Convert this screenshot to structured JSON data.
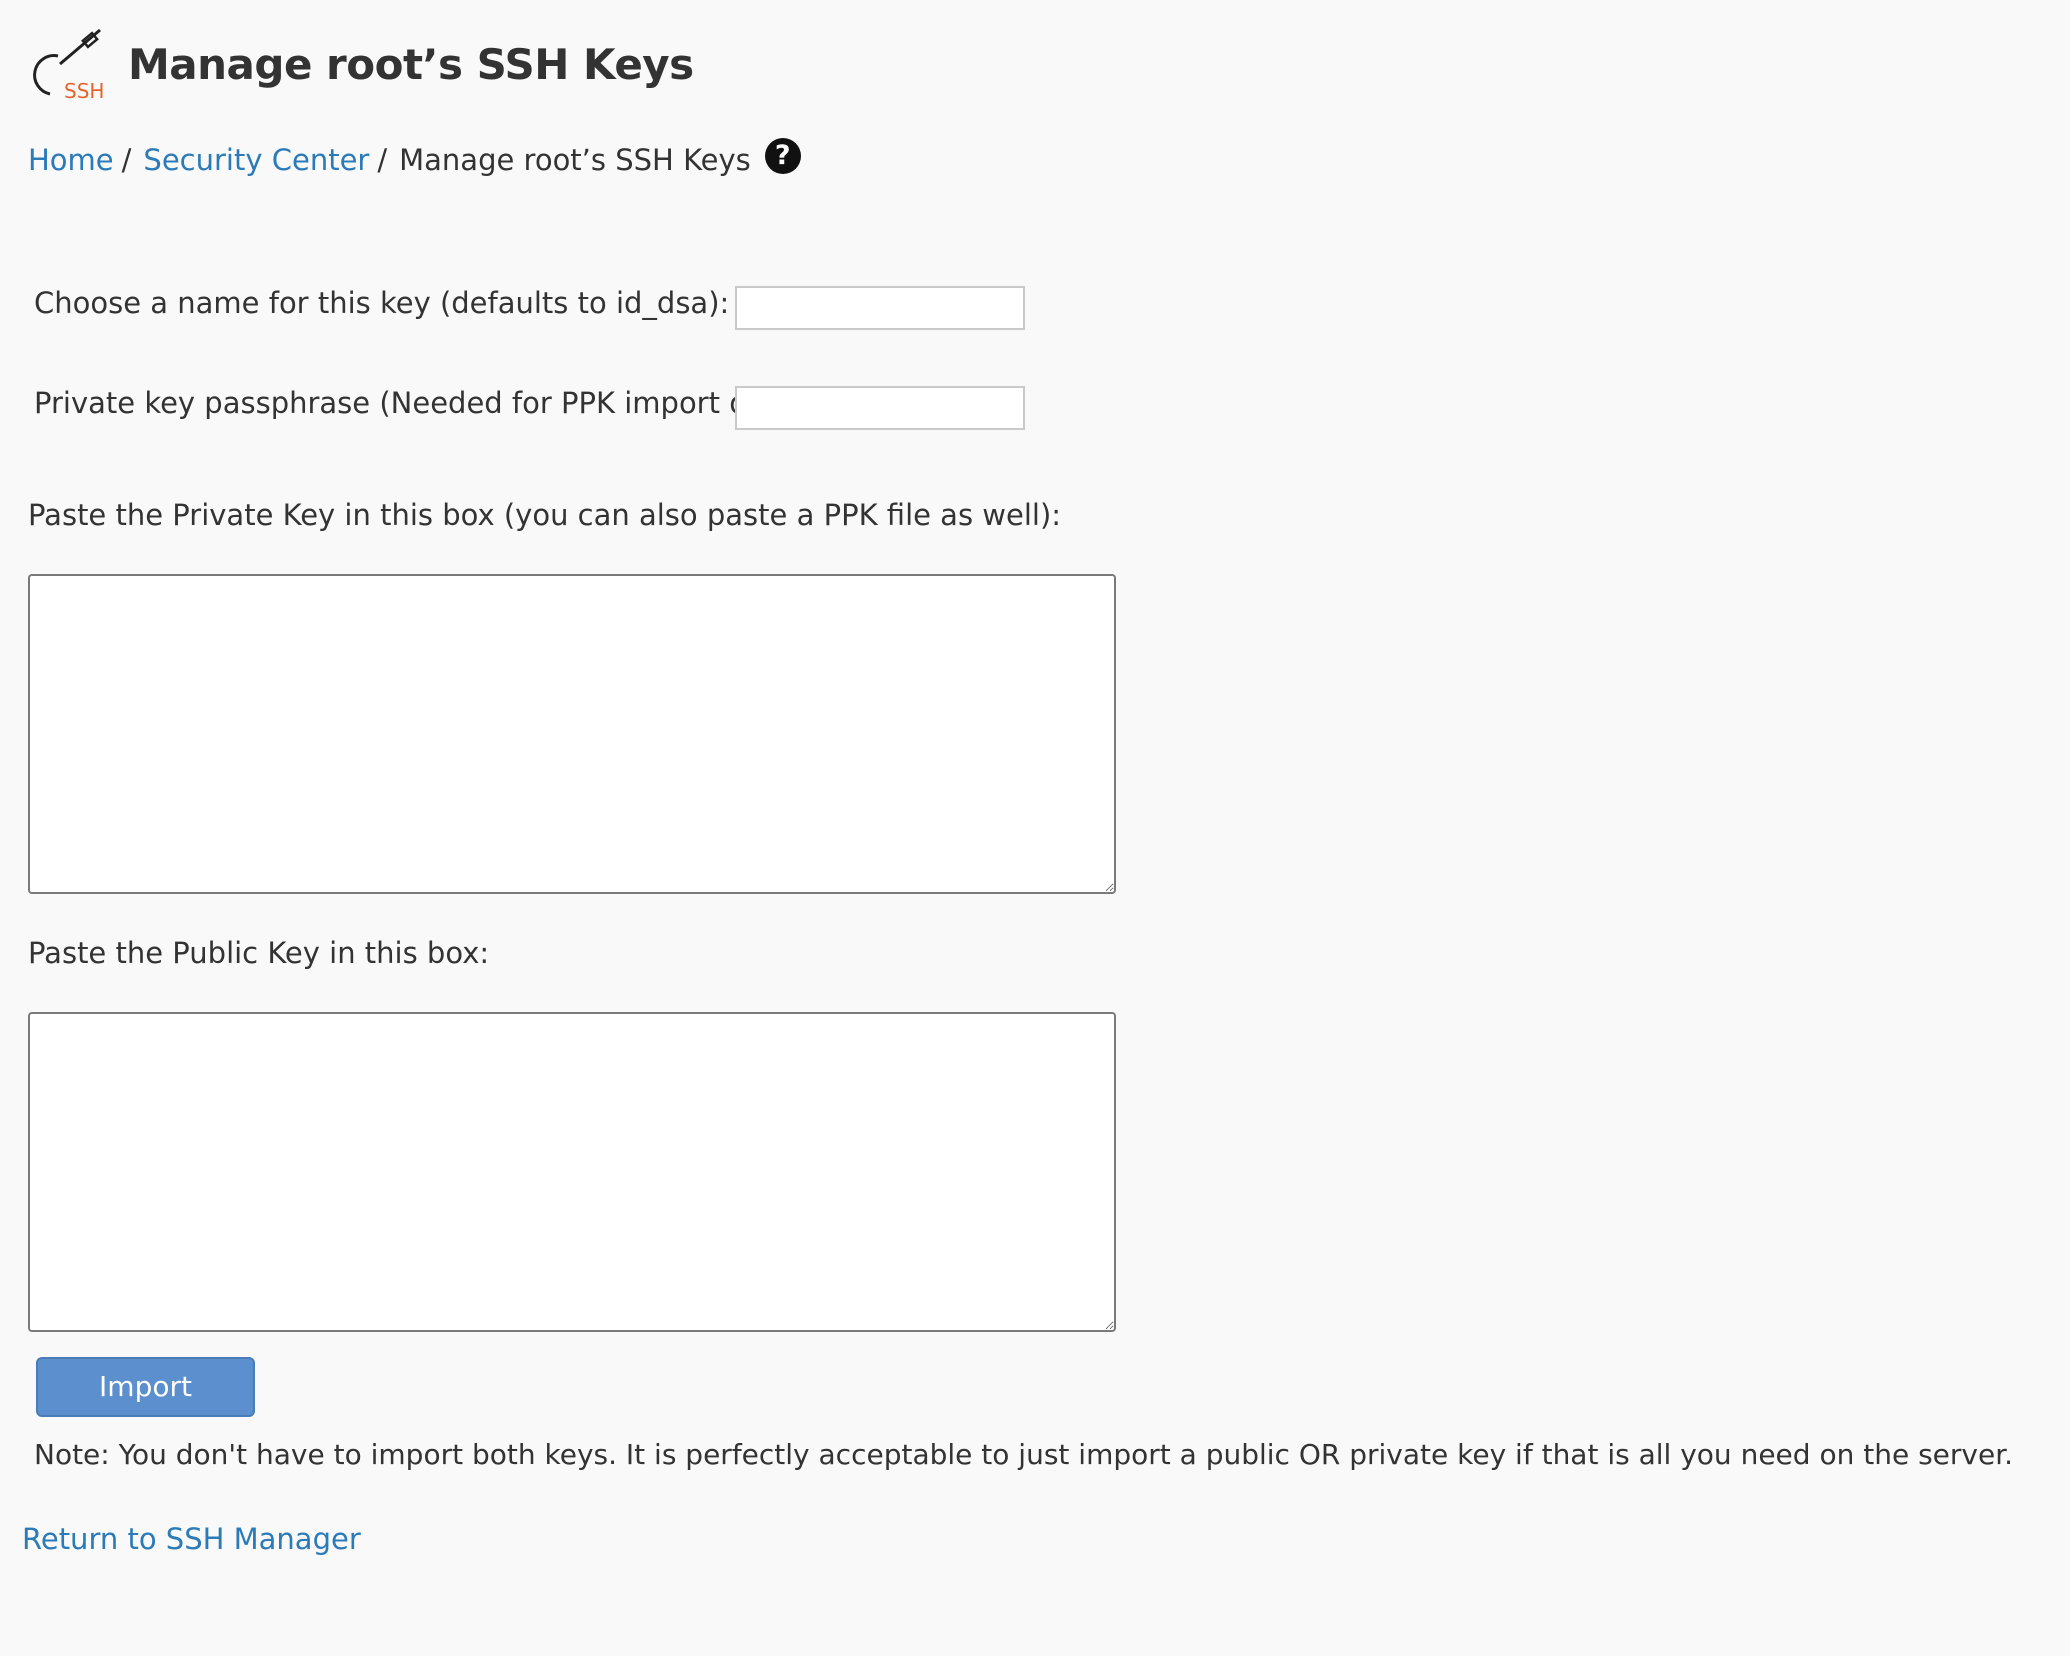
{
  "header": {
    "title": "Manage root’s SSH Keys",
    "logo_text": "SSH",
    "logo_icon": "ssh-key-icon"
  },
  "breadcrumb": {
    "items": [
      {
        "label": "Home"
      },
      {
        "label": "Security Center"
      },
      {
        "label": "Manage root’s SSH Keys"
      }
    ],
    "separator": "/",
    "help_icon": "question-circle-icon",
    "help_glyph": "?"
  },
  "form": {
    "key_name_label": "Choose a name for this key (defaults to id_dsa):",
    "key_name_value": "",
    "passphrase_label": "Private key passphrase (Needed for PPK import only):",
    "passphrase_value": "",
    "private_key_label": "Paste the Private Key in this box (you can also paste a PPK file as well):",
    "private_key_value": "",
    "public_key_label": "Paste the Public Key in this box:",
    "public_key_value": "",
    "import_button": "Import"
  },
  "note": "Note: You don't have to import both keys. It is perfectly acceptable to just import a public OR private key if that is all you need on the server.",
  "return_link": "Return to SSH Manager",
  "colors": {
    "link": "#2b7bb9",
    "button": "#5b8fcd",
    "logo_accent": "#e8622c",
    "background": "#f9f9f9"
  }
}
